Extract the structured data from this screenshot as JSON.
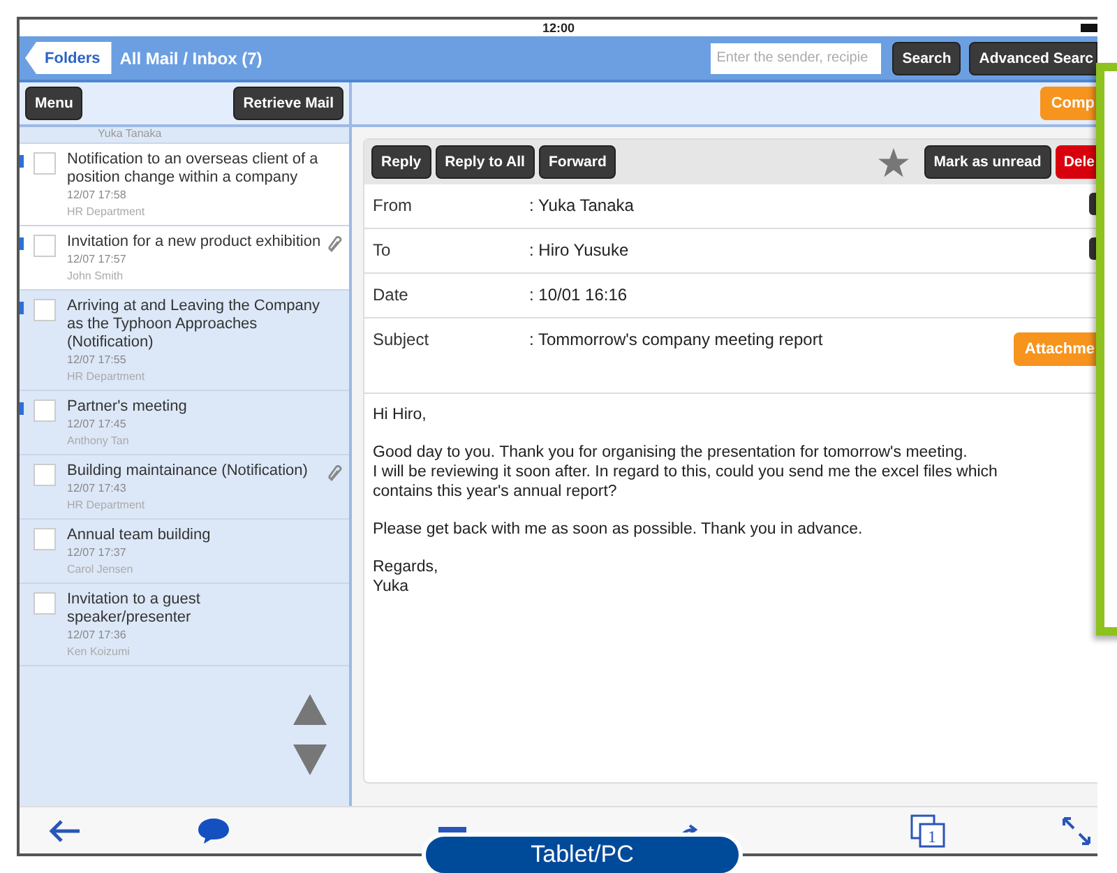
{
  "status_bar": {
    "time": "12:00"
  },
  "header": {
    "back_button": "Folders",
    "title": "All Mail / Inbox (7)",
    "search": {
      "placeholder": "Enter the sender, recipie"
    },
    "buttons": [
      "Search",
      "Advanced Searc"
    ]
  },
  "list_toolbar": {
    "buttons": [
      "Menu",
      "Retrieve Mail"
    ]
  },
  "compose_button": "Comp",
  "mail_list": {
    "partial_sender": "Yuka Tanaka",
    "items": [
      {
        "subject": "Notification to an overseas client of a position change within a company",
        "time": "12/07 17:58",
        "sender": "HR Department",
        "unread": true,
        "highlighted": false,
        "checked": false,
        "attachment": false
      },
      {
        "subject": "Invitation for a new product exhibition",
        "time": "12/07 17:57",
        "sender": "John Smith",
        "unread": true,
        "highlighted": false,
        "checked": false,
        "attachment": true
      },
      {
        "subject": "Arriving at and Leaving the Company as the Typhoon Approaches (Notification)",
        "time": "12/07 17:55",
        "sender": "HR Department",
        "unread": true,
        "highlighted": true,
        "checked": false,
        "attachment": false
      },
      {
        "subject": "Partner's meeting",
        "time": "12/07 17:45",
        "sender": "Anthony Tan",
        "unread": true,
        "highlighted": true,
        "checked": false,
        "attachment": false
      },
      {
        "subject": "Building maintainance (Notification)",
        "time": "12/07 17:43",
        "sender": "HR Department",
        "unread": false,
        "highlighted": true,
        "checked": false,
        "attachment": true
      },
      {
        "subject": "Annual team building",
        "time": "12/07 17:37",
        "sender": "Carol Jensen",
        "unread": false,
        "highlighted": true,
        "checked": false,
        "attachment": false
      },
      {
        "subject": "Invitation to a guest speaker/presenter",
        "time": "12/07 17:36",
        "sender": "Ken Koizumi",
        "unread": false,
        "highlighted": true,
        "checked": false,
        "attachment": false
      }
    ]
  },
  "message": {
    "toolbar": [
      {
        "label": "Reply",
        "kind": "dark"
      },
      {
        "label": "Reply to All",
        "kind": "dark"
      },
      {
        "label": "Forward",
        "kind": "dark"
      },
      {
        "kind": "star"
      },
      {
        "label": "Mark as unread",
        "kind": "dark"
      },
      {
        "label": "Dele",
        "kind": "danger"
      }
    ],
    "starred": false,
    "fields": [
      {
        "label": "From",
        "value": ": Yuka Tanaka",
        "kind": "address"
      },
      {
        "label": "To",
        "value": ": Hiro Yusuke",
        "kind": "address"
      },
      {
        "label": "Date",
        "value": ": 10/01 16:16",
        "kind": "plain"
      },
      {
        "label": "Subject",
        "value": ": Tommorrow's company meeting report",
        "kind": "attachment",
        "button": "Attachme"
      }
    ],
    "body": [
      [
        "Hi Hiro,"
      ],
      [
        "Good day to you.  Thank you for organising the presentation for tomorrow's meeting.",
        "I will be reviewing it soon after. In regard to this, could you send me the excel files which",
        "contains this year's annual report?"
      ],
      [
        "Please get back with me as soon as possible. Thank you in advance."
      ],
      [
        "Regards,",
        "Yuka"
      ]
    ]
  },
  "bottom_toolbar": {
    "page_count": "1"
  },
  "caption": "Tablet/PC"
}
